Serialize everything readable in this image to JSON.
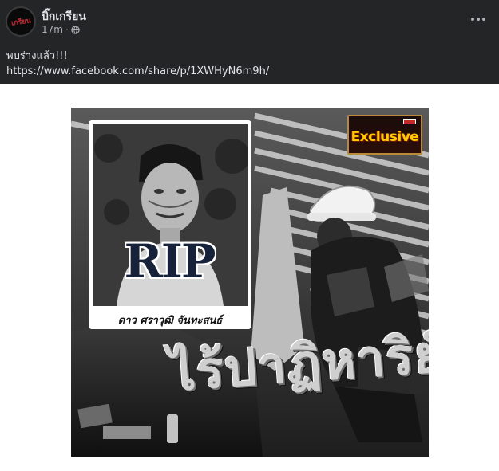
{
  "post": {
    "author": "บิ๊กเกรียน",
    "avatar_mark": "เกรียน",
    "timestamp": "17m",
    "separator": "·",
    "visibility_icon": "globe-icon",
    "more_icon": "more-options-icon",
    "text": "พบร่างแล้ว!!!",
    "link": "https://www.facebook.com/share/p/1XWHyN6m9h/"
  },
  "image": {
    "badge": "Exclusive",
    "rip": "RIP",
    "name": "ดาว ศราวุฒิ จันทะสนธ์",
    "headline": "ไร้ปาฏิหาริย์"
  },
  "colors": {
    "header_bg": "#242526",
    "header_text": "#e4e6eb",
    "meta_text": "#b0b3b8",
    "badge_text": "#ffcc00",
    "rip_text": "#16213a"
  }
}
